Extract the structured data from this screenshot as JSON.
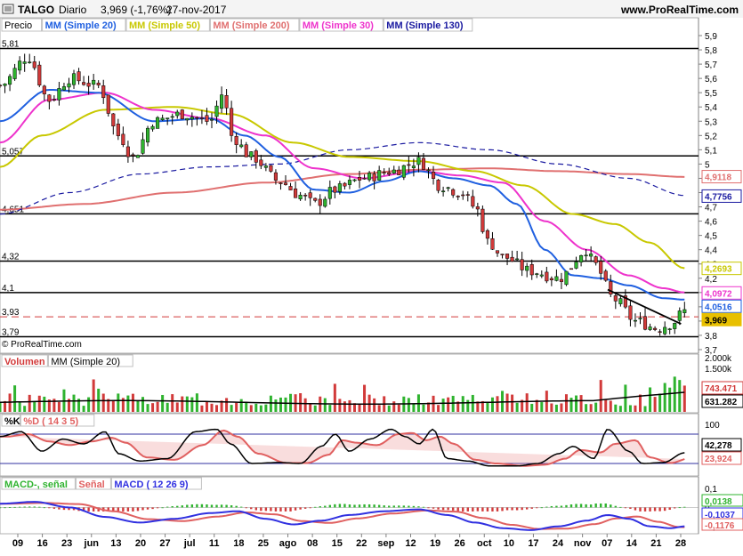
{
  "header": {
    "symbol": "TALGO",
    "period": "Diario",
    "quote": "3,969 (-1,76%)",
    "date": "27-nov-2017",
    "site": "www.ProRealTime.com",
    "copyright": "© ProRealTime.com"
  },
  "colors": {
    "bull": "#2fb32f",
    "bear": "#d23a3a",
    "mm20": "#2060e0",
    "mm50": "#c8c800",
    "mm200": "#e07070",
    "mm30": "#ee33cc",
    "mm130": "#1a1aa0",
    "macd": "#3030e0",
    "signal": "#e06060"
  },
  "chart_data": [
    {
      "type": "candlestick",
      "title": "Precio",
      "legend": [
        {
          "name": "Precio",
          "color": "#000000"
        },
        {
          "name": "MM (Simple 20)",
          "color": "#2060e0"
        },
        {
          "name": "MM (Simple 50)",
          "color": "#c8c800"
        },
        {
          "name": "MM (Simple 200)",
          "color": "#e07070"
        },
        {
          "name": "MM (Simple 30)",
          "color": "#ee33cc"
        },
        {
          "name": "MM (Simple 130)",
          "color": "#1a1aa0"
        }
      ],
      "x_ticks": [
        "09",
        "16",
        "23",
        "jun",
        "13",
        "20",
        "27",
        "jul",
        "11",
        "18",
        "25",
        "ago",
        "08",
        "15",
        "22",
        "sep",
        "12",
        "19",
        "26",
        "oct",
        "10",
        "17",
        "24",
        "nov",
        "07",
        "14",
        "21",
        "28"
      ],
      "y_ticks": [
        "5,9",
        "5,8",
        "5,7",
        "5,6",
        "5,5",
        "5,4",
        "5,3",
        "5,2",
        "5,1",
        "5",
        "4,9",
        "4,8",
        "4,7",
        "4,6",
        "4,5",
        "4,4",
        "4,3",
        "4,2",
        "4,1",
        "4",
        "3,9",
        "3,8",
        "3,7"
      ],
      "ylim": [
        3.7,
        5.9
      ],
      "levels": [
        {
          "label": "5,81",
          "value": 5.81,
          "style": "solid"
        },
        {
          "label": "5,057",
          "value": 5.057,
          "style": "solid"
        },
        {
          "label": "4,651",
          "value": 4.651,
          "style": "solid"
        },
        {
          "label": "4,32",
          "value": 4.32,
          "style": "solid"
        },
        {
          "label": "4,1",
          "value": 4.1,
          "style": "solid"
        },
        {
          "label": "3,93",
          "value": 3.93,
          "style": "dashed"
        },
        {
          "label": "3,79",
          "value": 3.79,
          "style": "solid"
        }
      ],
      "trendline": {
        "from": [
          0.87,
          4.12
        ],
        "to": [
          0.975,
          3.88
        ]
      },
      "ma_anchors": {
        "mm20": [
          [
            0,
            5.3
          ],
          [
            0.07,
            5.52
          ],
          [
            0.14,
            5.5
          ],
          [
            0.22,
            5.3
          ],
          [
            0.3,
            5.32
          ],
          [
            0.35,
            5.2
          ],
          [
            0.4,
            5.05
          ],
          [
            0.45,
            4.82
          ],
          [
            0.5,
            4.8
          ],
          [
            0.55,
            4.88
          ],
          [
            0.6,
            4.95
          ],
          [
            0.65,
            4.9
          ],
          [
            0.7,
            4.85
          ],
          [
            0.74,
            4.72
          ],
          [
            0.78,
            4.4
          ],
          [
            0.82,
            4.22
          ],
          [
            0.86,
            4.2
          ],
          [
            0.9,
            4.15
          ],
          [
            0.95,
            4.06
          ],
          [
            0.98,
            4.05
          ]
        ],
        "mm50": [
          [
            0,
            4.98
          ],
          [
            0.06,
            5.2
          ],
          [
            0.15,
            5.38
          ],
          [
            0.25,
            5.4
          ],
          [
            0.33,
            5.35
          ],
          [
            0.42,
            5.15
          ],
          [
            0.5,
            5.05
          ],
          [
            0.6,
            5.02
          ],
          [
            0.68,
            4.95
          ],
          [
            0.75,
            4.85
          ],
          [
            0.82,
            4.65
          ],
          [
            0.88,
            4.58
          ],
          [
            0.93,
            4.45
          ],
          [
            0.98,
            4.27
          ]
        ],
        "mm200": [
          [
            0,
            4.68
          ],
          [
            0.12,
            4.72
          ],
          [
            0.25,
            4.8
          ],
          [
            0.38,
            4.87
          ],
          [
            0.5,
            4.93
          ],
          [
            0.6,
            4.96
          ],
          [
            0.7,
            4.97
          ],
          [
            0.8,
            4.95
          ],
          [
            0.9,
            4.93
          ],
          [
            0.98,
            4.91
          ]
        ],
        "mm30": [
          [
            0,
            5.15
          ],
          [
            0.07,
            5.45
          ],
          [
            0.15,
            5.5
          ],
          [
            0.22,
            5.38
          ],
          [
            0.3,
            5.32
          ],
          [
            0.38,
            5.2
          ],
          [
            0.45,
            4.97
          ],
          [
            0.52,
            4.9
          ],
          [
            0.6,
            4.95
          ],
          [
            0.66,
            4.92
          ],
          [
            0.72,
            4.87
          ],
          [
            0.78,
            4.6
          ],
          [
            0.84,
            4.4
          ],
          [
            0.9,
            4.22
          ],
          [
            0.95,
            4.13
          ],
          [
            0.98,
            4.1
          ]
        ],
        "mm130": [
          [
            0,
            4.65
          ],
          [
            0.1,
            4.8
          ],
          [
            0.2,
            4.93
          ],
          [
            0.3,
            4.98
          ],
          [
            0.4,
            5.0
          ],
          [
            0.5,
            5.1
          ],
          [
            0.6,
            5.15
          ],
          [
            0.7,
            5.1
          ],
          [
            0.8,
            5.0
          ],
          [
            0.9,
            4.9
          ],
          [
            0.98,
            4.78
          ]
        ]
      },
      "price_path": [
        [
          0,
          5.55
        ],
        [
          0.04,
          5.75
        ],
        [
          0.07,
          5.45
        ],
        [
          0.1,
          5.6
        ],
        [
          0.14,
          5.55
        ],
        [
          0.17,
          5.2
        ],
        [
          0.19,
          5.05
        ],
        [
          0.22,
          5.3
        ],
        [
          0.26,
          5.35
        ],
        [
          0.3,
          5.3
        ],
        [
          0.32,
          5.5
        ],
        [
          0.33,
          5.2
        ],
        [
          0.36,
          5.05
        ],
        [
          0.4,
          4.88
        ],
        [
          0.43,
          4.78
        ],
        [
          0.45,
          4.72
        ],
        [
          0.48,
          4.82
        ],
        [
          0.52,
          4.9
        ],
        [
          0.56,
          4.95
        ],
        [
          0.6,
          5.02
        ],
        [
          0.63,
          4.85
        ],
        [
          0.66,
          4.8
        ],
        [
          0.68,
          4.7
        ],
        [
          0.7,
          4.45
        ],
        [
          0.72,
          4.35
        ],
        [
          0.76,
          4.25
        ],
        [
          0.8,
          4.2
        ],
        [
          0.84,
          4.4
        ],
        [
          0.85,
          4.3
        ],
        [
          0.88,
          4.05
        ],
        [
          0.91,
          3.9
        ],
        [
          0.94,
          3.85
        ],
        [
          0.96,
          3.88
        ],
        [
          0.98,
          3.97
        ]
      ],
      "badges": [
        {
          "label": "4,9118",
          "value": 4.9118,
          "color": "#e07070"
        },
        {
          "label": "4,7756",
          "value": 4.7756,
          "color": "#1a1aa0"
        },
        {
          "label": "4,2693",
          "value": 4.2693,
          "color": "#c8c800"
        },
        {
          "label": "4,0972",
          "value": 4.0972,
          "color": "#ee33cc"
        },
        {
          "label": "4,0516",
          "value": 4.0516,
          "color": "#2060e0"
        },
        {
          "label": "3,969",
          "value": 3.969,
          "color": "#e8c000",
          "filled": true
        }
      ]
    },
    {
      "type": "bar",
      "title": "Volumen",
      "legend": [
        {
          "name": "Volumen",
          "color": "#d23a3a"
        },
        {
          "name": "MM (Simple 20)",
          "color": "#000000"
        }
      ],
      "y_ticks": [
        "2.000k",
        "1.500k"
      ],
      "ylim": [
        0,
        2000000
      ],
      "badges": [
        {
          "label": "743.471",
          "value": 743471,
          "color": "#d23a3a"
        },
        {
          "label": "631.282",
          "value": 631282,
          "color": "#000000"
        }
      ]
    },
    {
      "type": "line",
      "title": "%K %D (14 3 5)",
      "legend": [
        {
          "name": "%K",
          "color": "#000000"
        },
        {
          "name": "%D ( 14 3 5)",
          "color": "#e06060"
        }
      ],
      "y_ticks": [
        "100"
      ],
      "ylim": [
        0,
        100
      ],
      "levels": [
        80,
        20
      ],
      "badges": [
        {
          "label": "42,278",
          "value": 42.278,
          "color": "#000000"
        },
        {
          "label": "23,924",
          "value": 23.924,
          "color": "#e06060"
        }
      ]
    },
    {
      "type": "line",
      "title": "MACD",
      "legend": [
        {
          "name": "MACD-, señal",
          "color": "#2fb32f"
        },
        {
          "name": "Señal",
          "color": "#e06060"
        },
        {
          "name": "MACD ( 12 26 9)",
          "color": "#3030e0"
        }
      ],
      "y_ticks": [
        "0,1",
        "0",
        "-0,1"
      ],
      "ylim": [
        -0.13,
        0.12
      ],
      "badges": [
        {
          "label": "0,0138",
          "value": 0.0138,
          "color": "#2fb32f"
        },
        {
          "label": "-0,1037",
          "value": -0.1037,
          "color": "#3030e0"
        },
        {
          "label": "-0,1176",
          "value": -0.1176,
          "color": "#e06060"
        }
      ]
    }
  ]
}
